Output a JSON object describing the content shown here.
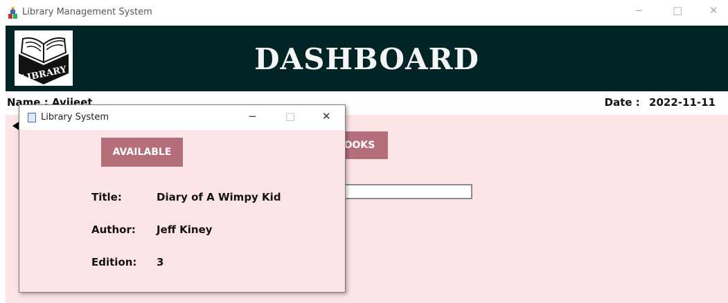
{
  "window": {
    "title": "Library Management System",
    "controls": [
      "−",
      "□",
      "✕"
    ]
  },
  "header": {
    "logo_text": "LIBRARY",
    "title": "DASHBOARD",
    "bg_color": "#012427"
  },
  "user": {
    "name_label": "Name : Avijeet",
    "date_label": "Date :",
    "date_value": "2022-11-11"
  },
  "main": {
    "books_button_label": "OOKS",
    "search_value": ""
  },
  "popup": {
    "title": "Library System",
    "controls": [
      "−",
      "□",
      "✕"
    ],
    "status_button": "AVAILABLE",
    "fields": [
      {
        "label": "Title:",
        "value": "Diary of A Wimpy Kid"
      },
      {
        "label": "Author:",
        "value": "Jeff Kiney"
      },
      {
        "label": "Edition:",
        "value": "3"
      }
    ]
  },
  "colors": {
    "accent": "#b56f7a",
    "background": "#fde4e7"
  }
}
